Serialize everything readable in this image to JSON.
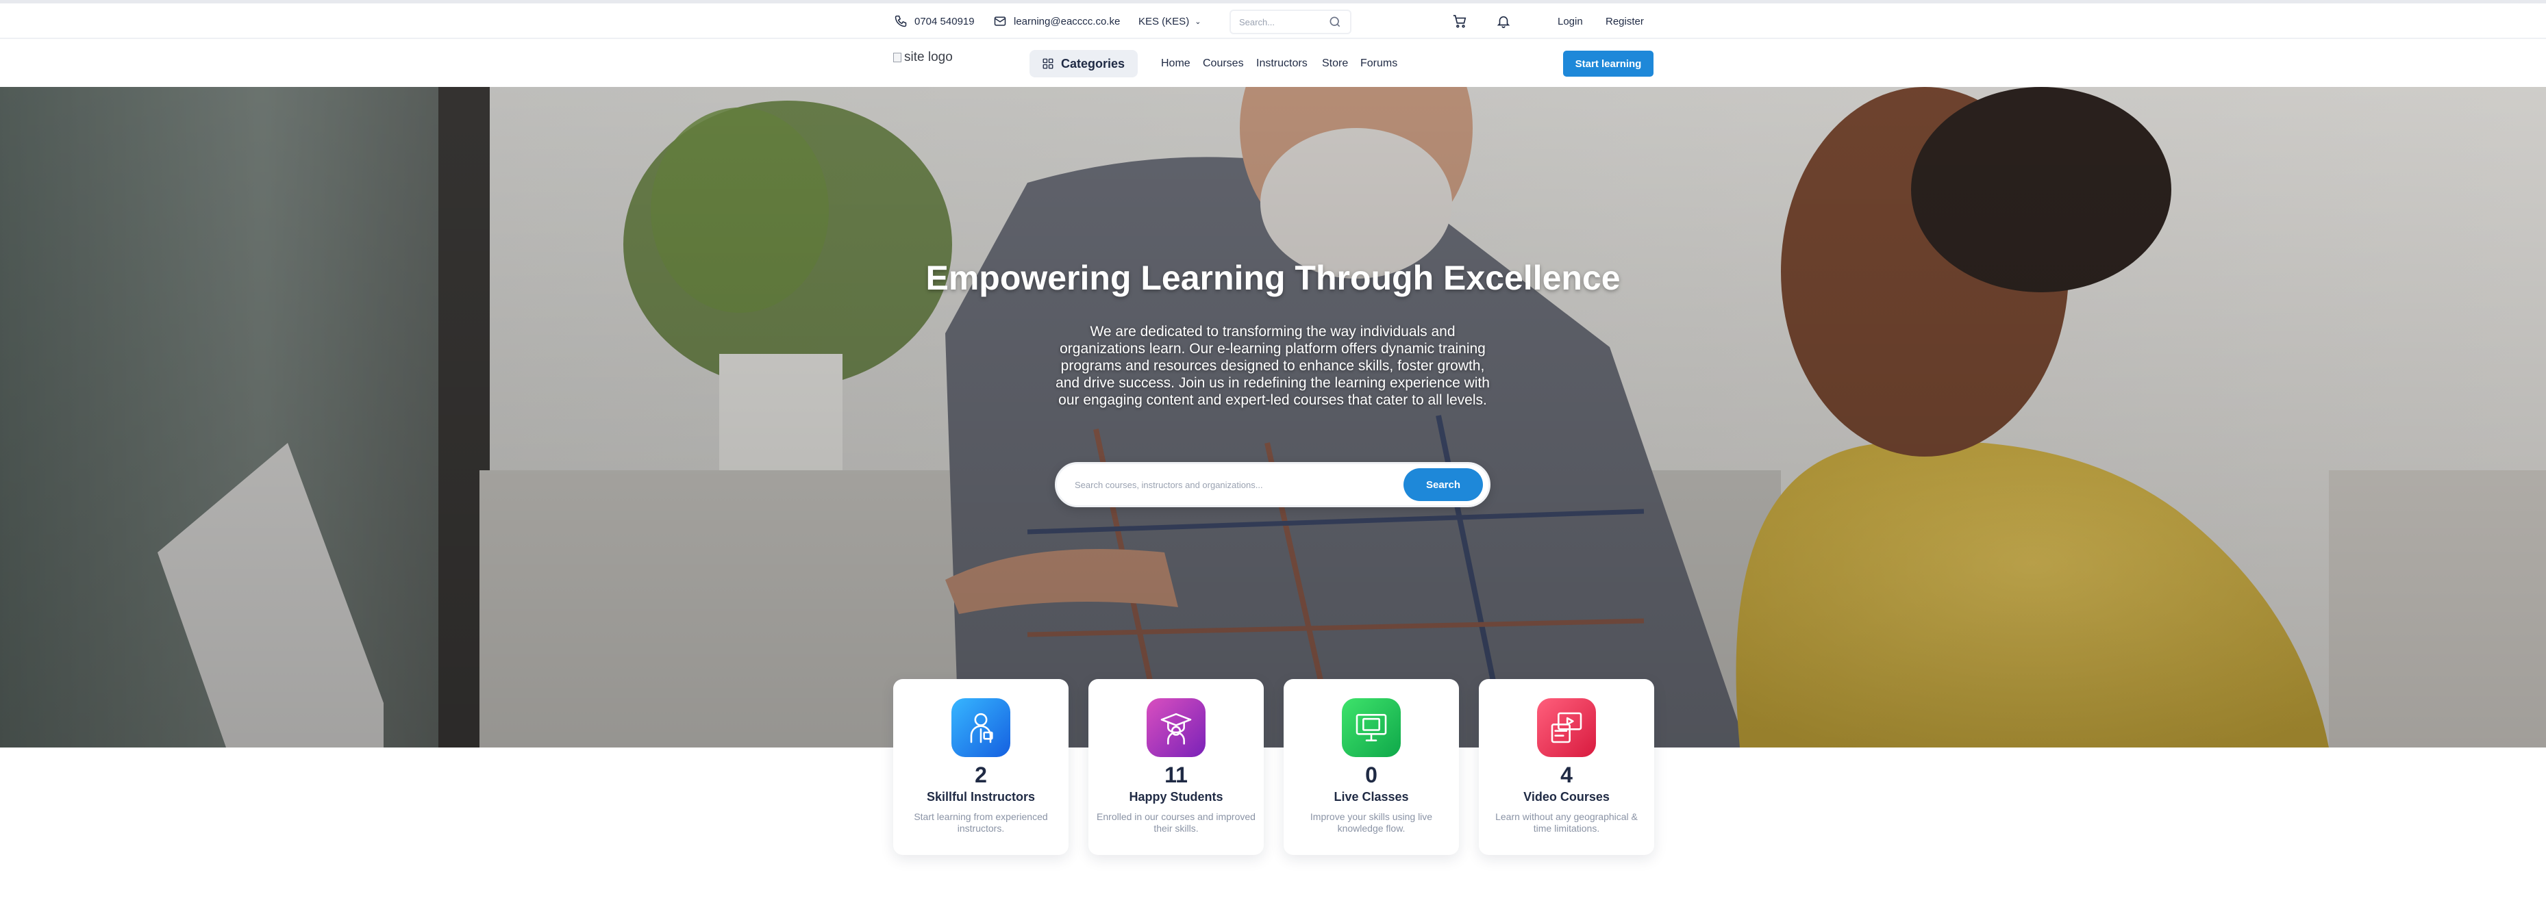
{
  "topbar": {
    "phone": "0704 540919",
    "email": "learning@eacccc.co.ke",
    "currency": "KES (KES)",
    "search_placeholder": "Search...",
    "login": "Login",
    "register": "Register"
  },
  "nav": {
    "logo_alt": "site logo",
    "categories": "Categories",
    "links": [
      "Home",
      "Courses",
      "Instructors",
      "Store",
      "Forums"
    ],
    "cta": "Start learning"
  },
  "hero": {
    "title": "Empowering Learning Through Excellence",
    "description": "We are dedicated to transforming the way individuals and organizations learn. Our e-learning platform offers dynamic training programs and resources designed to enhance skills, foster growth, and drive success. Join us in redefining the learning experience with our engaging content and expert-led courses that cater to all levels.",
    "search_placeholder": "Search courses, instructors and organizations...",
    "search_button": "Search"
  },
  "stats": [
    {
      "value": "2",
      "label": "Skillful Instructors",
      "desc": "Start learning from experienced instructors.",
      "icon": "instructor-icon",
      "color": "#1e88e5"
    },
    {
      "value": "11",
      "label": "Happy Students",
      "desc": "Enrolled in our courses and improved their skills.",
      "icon": "graduate-icon",
      "color": "#a333c8"
    },
    {
      "value": "0",
      "label": "Live Classes",
      "desc": "Improve your skills using live knowledge flow.",
      "icon": "live-class-icon",
      "color": "#22c55e"
    },
    {
      "value": "4",
      "label": "Video Courses",
      "desc": "Learn without any geographical & time limitations.",
      "icon": "video-course-icon",
      "color": "#f43f5e"
    }
  ]
}
